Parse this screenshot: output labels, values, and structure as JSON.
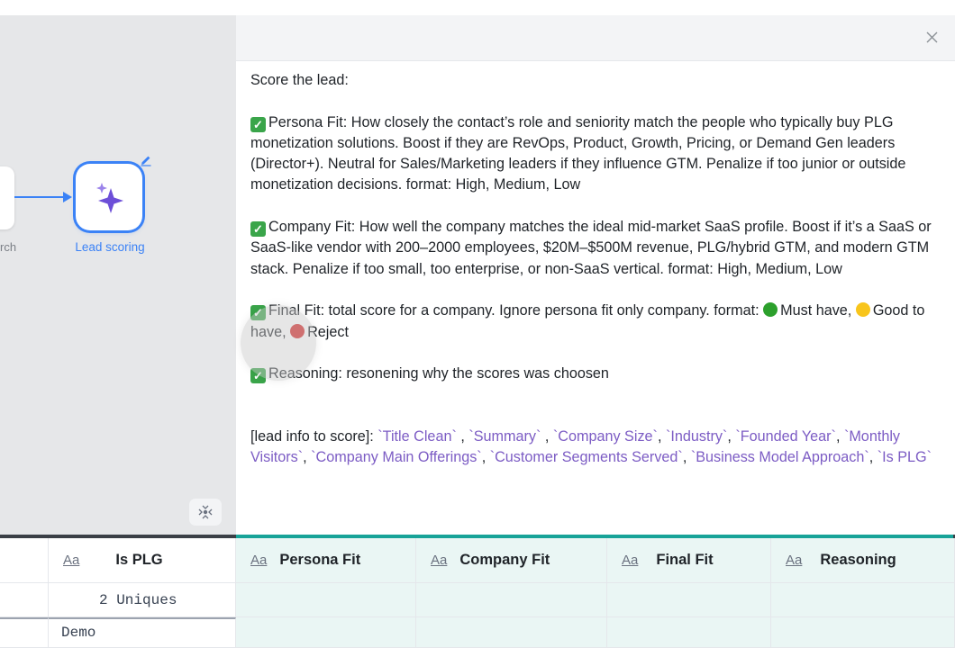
{
  "canvas": {
    "prev_node_label": "rch",
    "node_label": "Lead scoring"
  },
  "prompt": {
    "line0": "Score the lead:",
    "persona": "Persona Fit: How closely the contact’s role and seniority match the people who typically buy PLG monetization solutions. Boost if they are RevOps, Product, Growth, Pricing, or Demand Gen leaders (Director+). Neutral for Sales/Marketing leaders if they influence GTM. Penalize if too junior or outside monetization decisions. format: High,  Medium,  Low",
    "company": "Company Fit: How well the company matches the ideal mid-market SaaS profile. Boost if it’s a SaaS or SaaS-like vendor with 200–2000 employees, $20M–$500M revenue, PLG/hybrid GTM, and modern GTM stack. Penalize if too small, too enterprise, or non-SaaS vertical. format: High, Medium,  Low",
    "final_pre": "Final Fit: total score for a company. Ignore persona fit only company. format:",
    "final_must": "Must have,",
    "final_good": "Good to have,",
    "final_reject": "Reject",
    "reasoning": "Reasoning: resonening why the scores was choosen",
    "lead_info_label": "[lead info to score]:",
    "variables": [
      "`Title Clean`",
      "`Summary`",
      "`Company Size`",
      "`Industry`",
      "`Founded Year`",
      "`Monthly Visitors`",
      "`Company Main Offerings`",
      "`Customer Segments Served`",
      "`Business Model Approach`",
      "`Is PLG`"
    ]
  },
  "table": {
    "type_marker": "Aa",
    "columns": [
      "Is PLG",
      "Persona Fit",
      "Company Fit",
      "Final Fit",
      "Reasoning"
    ],
    "summary": "2 Uniques",
    "first_value": "Demo"
  },
  "icons": {
    "node": "sparkles-icon",
    "edit": "pencil-icon",
    "close": "close-icon",
    "collapse": "collapse-icon"
  },
  "colors": {
    "accent_blue": "#3b82f6",
    "node_purple": "#6d4fd8",
    "variable_purple": "#7c5cc4",
    "teal_bar": "#17a398",
    "check_green": "#3aa54a"
  }
}
